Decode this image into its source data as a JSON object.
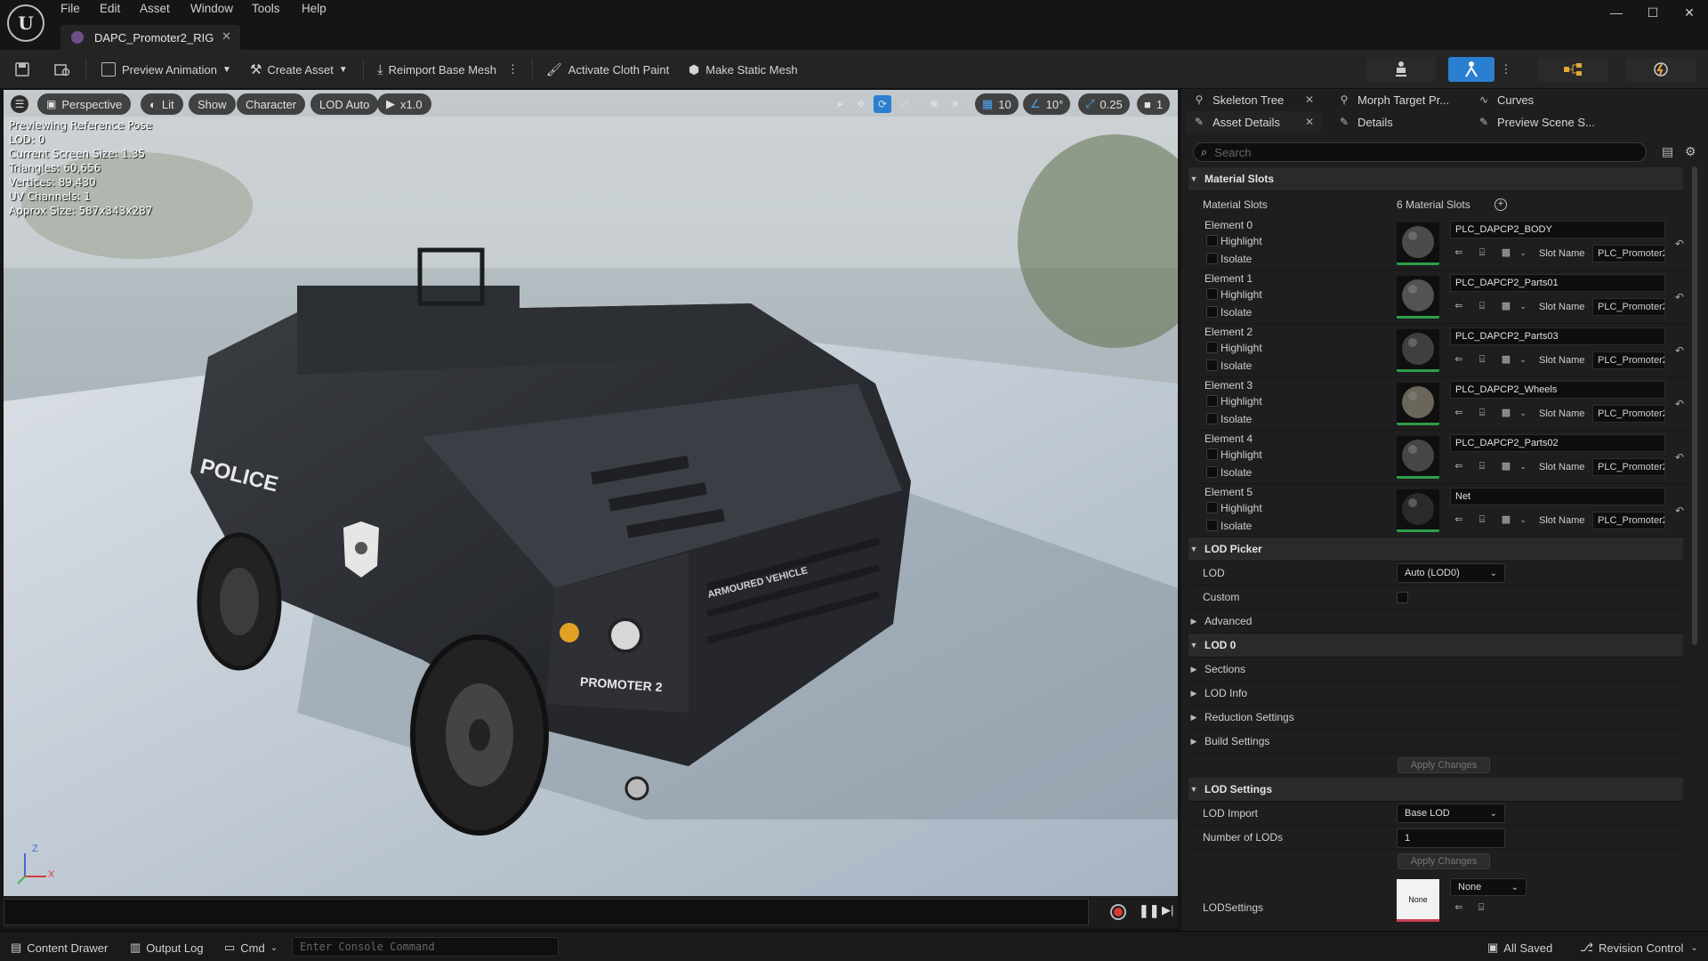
{
  "menu": [
    "File",
    "Edit",
    "Asset",
    "Window",
    "Tools",
    "Help"
  ],
  "document_tab": "DAPC_Promoter2_RIG",
  "toolbar": {
    "preview_animation": "Preview Animation",
    "create_asset": "Create Asset",
    "reimport": "Reimport Base Mesh",
    "cloth_paint": "Activate Cloth Paint",
    "static_mesh": "Make Static Mesh"
  },
  "viewport": {
    "perspective": "Perspective",
    "lit": "Lit",
    "show": "Show",
    "character": "Character",
    "lod": "LOD Auto",
    "speed": "x1.0",
    "grid": "10",
    "angle": "10°",
    "scale": "0.25",
    "camera": "1",
    "stats": [
      "Previewing Reference Pose",
      "LOD: 0",
      "Current Screen Size: 1.35",
      "Triangles: 60,656",
      "Vertices: 89,430",
      "UV Channels: 1",
      "Approx Size: 587x343x287"
    ],
    "axis_z": "Z",
    "axis_x": "X",
    "vehicle_text": {
      "police": "POLICE",
      "promoter": "PROMOTER 2",
      "armoured": "ARMOURED VEHICLE"
    }
  },
  "status": {
    "content_drawer": "Content Drawer",
    "output_log": "Output Log",
    "cmd": "Cmd",
    "console_placeholder": "Enter Console Command",
    "all_saved": "All Saved",
    "revision": "Revision Control"
  },
  "panel_tabs": {
    "skeleton_tree": "Skeleton Tree",
    "morph": "Morph Target Pr...",
    "curves": "Curves",
    "asset_details": "Asset Details",
    "details": "Details",
    "preview_scene": "Preview Scene S..."
  },
  "search_placeholder": "Search",
  "material_slots": {
    "header": "Material Slots",
    "label": "Material Slots",
    "count": "6 Material Slots",
    "highlight": "Highlight",
    "isolate": "Isolate",
    "slot_name_label": "Slot Name",
    "elements": [
      {
        "name": "Element 0",
        "material": "PLC_DAPCP2_BODY",
        "slot": "PLC_Promoter2"
      },
      {
        "name": "Element 1",
        "material": "PLC_DAPCP2_Parts01",
        "slot": "PLC_Promoter2"
      },
      {
        "name": "Element 2",
        "material": "PLC_DAPCP2_Parts03",
        "slot": "PLC_Promoter2"
      },
      {
        "name": "Element 3",
        "material": "PLC_DAPCP2_Wheels",
        "slot": "PLC_Promoter2"
      },
      {
        "name": "Element 4",
        "material": "PLC_DAPCP2_Parts02",
        "slot": "PLC_Promoter2"
      },
      {
        "name": "Element 5",
        "material": "Net",
        "slot": "PLC_Promoter2"
      }
    ]
  },
  "lod_picker": {
    "header": "LOD Picker",
    "lod_label": "LOD",
    "lod_value": "Auto (LOD0)",
    "custom_label": "Custom",
    "advanced": "Advanced"
  },
  "lod0": {
    "header": "LOD 0",
    "sections": "Sections",
    "lod_info": "LOD Info",
    "reduction": "Reduction Settings",
    "build": "Build Settings",
    "apply": "Apply Changes"
  },
  "lod_settings": {
    "header": "LOD Settings",
    "import_label": "LOD Import",
    "import_value": "Base LOD",
    "num_label": "Number of LODs",
    "num_value": "1",
    "apply": "Apply Changes",
    "lodsettings_label": "LODSettings",
    "lodsettings_value": "None",
    "thumb_text": "None"
  }
}
